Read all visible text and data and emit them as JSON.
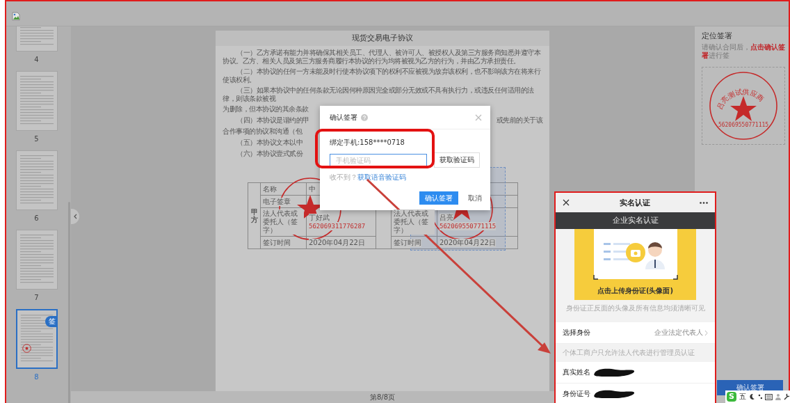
{
  "sidebar": {
    "pages": [
      {
        "label": "4",
        "selected": false
      },
      {
        "label": "5",
        "selected": false
      },
      {
        "label": "6",
        "selected": false
      },
      {
        "label": "7",
        "selected": false
      },
      {
        "label": "8",
        "selected": true,
        "badge": "签"
      }
    ]
  },
  "document": {
    "title": "现货交易电子协议",
    "paragraphs": [
      "（一）乙方承诺有能力并将确保其相关员工、代理人、被许可人、被授权人及第三方服务商知悉并遵守本协议。乙方、相关人员及第三方服务商履行本协议的行为均将被视为乙方的行为，并由乙方承担责任。",
      "（二）本协议的任何一方未能及时行使本协议项下的权利不应被视为放弃该权利，也不影响该方在将来行使该权利。",
      "（三）如果本协议中的任何条款无论因何种原因完全或部分无效或不具有执行力，或违反任何适用的法律，则该条款被视"
    ],
    "split_lines": [
      {
        "kind": "continuation",
        "left": "为删除，但本协议的其余条款"
      },
      {
        "kind": "start",
        "left": "（四）本协议是谐约的甲",
        "right": "或先前的关于该"
      },
      {
        "kind": "continuation",
        "left": "合作事项的协议和沟通（包"
      },
      {
        "kind": "start",
        "left": "（五）本协议文本以中"
      },
      {
        "kind": "start",
        "left": "（六）本协议壹式贰份"
      }
    ],
    "table": {
      "party": "甲方",
      "rows": [
        {
          "label": "名称",
          "value": "中"
        },
        {
          "label": "电子签章"
        },
        {
          "label": "法人代表或委托人（签字）",
          "value": "丁好武",
          "right_label": "法人代表或委托人（签字）",
          "right_value": "吕亮"
        },
        {
          "label": "签订时间",
          "value": "2020年04月22日",
          "right_label": "签订时间",
          "right_value": "2020年04月22日"
        }
      ]
    },
    "stamps": [
      {
        "number": "562069311776287",
        "selected": false
      },
      {
        "number": "562069550771115",
        "selected": true
      }
    ],
    "page_indicator": "第8/8页"
  },
  "sign_panel": {
    "title": "定位签署",
    "hint": "请确认合同后，**点击确认签署**进行签",
    "stamp": {
      "name": "吕亮测试供应商",
      "number": "562069550771115"
    },
    "button": "确认签署"
  },
  "dialog": {
    "title": "确认签署",
    "phone_label": "绑定手机:158****0718",
    "code_placeholder": "手机验证码",
    "get_code_button": "获取验证码",
    "fallback_text": "收不到？",
    "voice_link": "获取语音验证码",
    "confirm_button": "确认签署",
    "cancel_button": "取消"
  },
  "mobile": {
    "title": "实名认证",
    "banner": "企业实名认证",
    "upload_label": "点击上传身份证(头像面)",
    "upload_hint": "身份证正反面的头像及所有信息均须清晰可见",
    "fields": [
      {
        "kind": "select",
        "label": "选择身份",
        "value": "企业法定代表人"
      },
      {
        "kind": "note",
        "label": "个体工商户只允许法人代表进行管理员认证"
      },
      {
        "kind": "redacted",
        "label": "真实姓名"
      },
      {
        "kind": "redacted",
        "label": "身份证号"
      }
    ]
  },
  "ime_bar": {
    "logo": "S",
    "mode": "五"
  }
}
